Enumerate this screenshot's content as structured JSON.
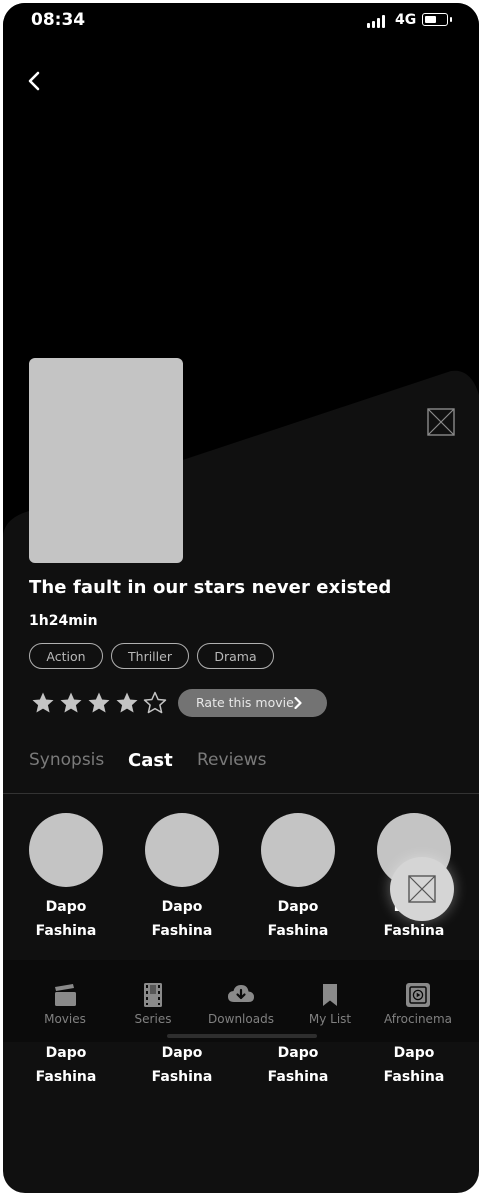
{
  "status_bar": {
    "time": "08:34",
    "network": "4G"
  },
  "movie": {
    "title": "The fault in our stars never existed",
    "duration": "1h24min",
    "genres": [
      "Action",
      "Thriller",
      "Drama"
    ],
    "rating": 4,
    "rating_max": 5,
    "rate_label": "Rate this movie"
  },
  "tabs": [
    {
      "label": "Synopsis",
      "active": false
    },
    {
      "label": "Cast",
      "active": true
    },
    {
      "label": "Reviews",
      "active": false
    }
  ],
  "cast_rows": [
    [
      {
        "first": "Dapo",
        "last": "Fashina"
      },
      {
        "first": "Dapo",
        "last": "Fashina"
      },
      {
        "first": "Dapo",
        "last": "Fashina"
      },
      {
        "first": "Dapo",
        "last": "Fashina"
      }
    ],
    [
      {
        "first": "Dapo",
        "last": "Fashina"
      },
      {
        "first": "Dapo",
        "last": "Fashina"
      },
      {
        "first": "Dapo",
        "last": "Fashina"
      },
      {
        "first": "Dapo",
        "last": "Fashina"
      }
    ]
  ],
  "bottom_nav": [
    {
      "label": "Movies",
      "icon": "clapperboard-icon"
    },
    {
      "label": "Series",
      "icon": "film-strip-icon"
    },
    {
      "label": "Downloads",
      "icon": "cloud-download-icon"
    },
    {
      "label": "My List",
      "icon": "bookmark-icon"
    },
    {
      "label": "Afrocinema",
      "icon": "play-tile-icon"
    }
  ],
  "colors": {
    "background": "#101010",
    "poster_placeholder": "#c4c4c4",
    "rate_button": "#737373",
    "nav_label": "#808080"
  }
}
